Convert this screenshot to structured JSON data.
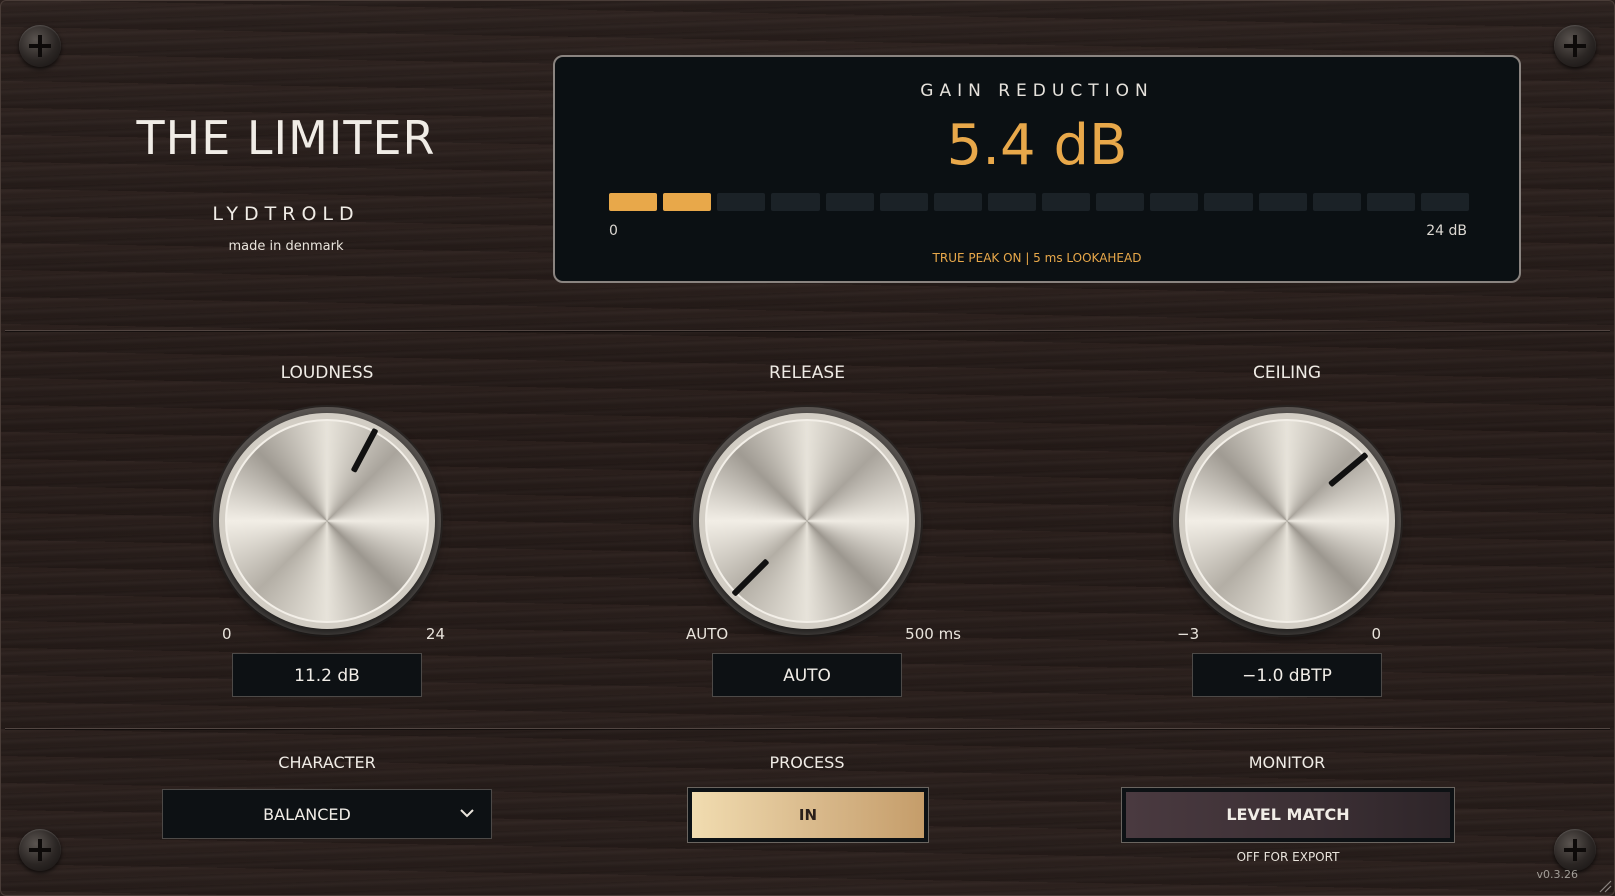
{
  "header": {
    "title": "THE LIMITER",
    "brand": "LYDTROLD",
    "tagline": "made in denmark"
  },
  "meter": {
    "title": "GAIN REDUCTION",
    "value": "5.4 dB",
    "scale_min": "0",
    "scale_max": "24 dB",
    "segments_total": 16,
    "segments_lit": 2,
    "status": "TRUE PEAK ON  |  5 ms LOOKAHEAD",
    "accent_color": "#e8a84a"
  },
  "knobs": {
    "loudness": {
      "label": "LOUDNESS",
      "min": "0",
      "max": "24",
      "value": "11.2 dB",
      "pointer_angle_deg": 28
    },
    "release": {
      "label": "RELEASE",
      "min": "AUTO",
      "max": "500 ms",
      "value": "AUTO",
      "pointer_angle_deg": -135
    },
    "ceiling": {
      "label": "CEILING",
      "min": "−3",
      "max": "0",
      "value": "−1.0 dBTP",
      "pointer_angle_deg": 50
    }
  },
  "controls": {
    "character": {
      "label": "CHARACTER",
      "selected": "BALANCED"
    },
    "process": {
      "label": "PROCESS",
      "button": "IN"
    },
    "monitor": {
      "label": "MONITOR",
      "button": "LEVEL MATCH",
      "note": "OFF FOR EXPORT"
    }
  },
  "footer": {
    "version": "v0.3.26"
  }
}
